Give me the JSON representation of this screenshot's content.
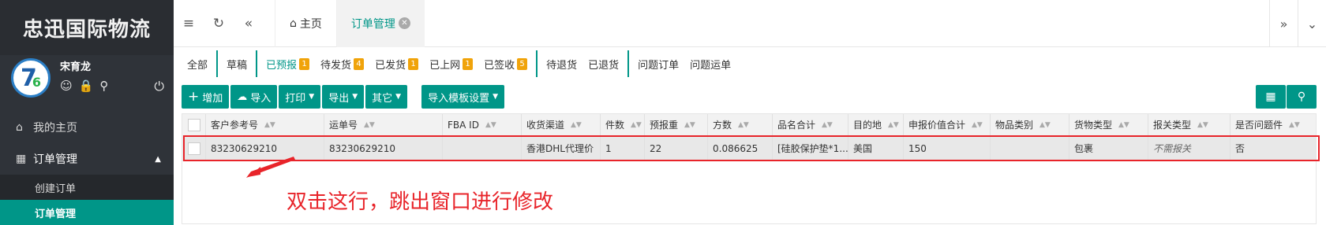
{
  "sidebar": {
    "brand": "忠迅国际物流",
    "username": "宋育龙",
    "avatar_text": "7",
    "avatar_sub": "6",
    "menu": [
      {
        "label": "我的主页",
        "icon": "home-icon"
      },
      {
        "label": "订单管理",
        "icon": "grid-icon"
      }
    ],
    "sub_items": [
      {
        "label": "创建订单"
      },
      {
        "label": "订单管理"
      }
    ]
  },
  "topbar": {
    "tabs": [
      {
        "label": "主页"
      },
      {
        "label": "订单管理"
      }
    ]
  },
  "status_tabs": [
    {
      "label": "全部"
    },
    {
      "label": "草稿"
    },
    {
      "label": "已预报",
      "badge": "1"
    },
    {
      "label": "待发货",
      "badge": "4"
    },
    {
      "label": "已发货",
      "badge": "1"
    },
    {
      "label": "已上网",
      "badge": "1"
    },
    {
      "label": "已签收",
      "badge": "5"
    },
    {
      "label": "待退货"
    },
    {
      "label": "已退货"
    },
    {
      "label": "问题订单"
    },
    {
      "label": "问题运单"
    }
  ],
  "toolbar": {
    "add": "增加",
    "import": "导入",
    "print": "打印",
    "export": "导出",
    "other": "其它",
    "import_template": "导入模板设置"
  },
  "table": {
    "columns": [
      "客户参考号",
      "运单号",
      "FBA ID",
      "收货渠道",
      "件数",
      "预报重",
      "方数",
      "品名合计",
      "目的地",
      "申报价值合计",
      "物品类别",
      "货物类型",
      "报关类型",
      "是否问题件"
    ],
    "rows": [
      [
        "83230629210",
        "83230629210",
        "",
        "香港DHL代理价",
        "1",
        "22",
        "0.086625",
        "[硅胶保护垫*1...",
        "美国",
        "150",
        "",
        "包裹",
        "不需报关",
        "否"
      ]
    ]
  },
  "annotation": "双击这行，跳出窗口进行修改",
  "colors": {
    "accent": "#009688",
    "badge": "#f0a30a",
    "annotation": "#e8242a"
  }
}
